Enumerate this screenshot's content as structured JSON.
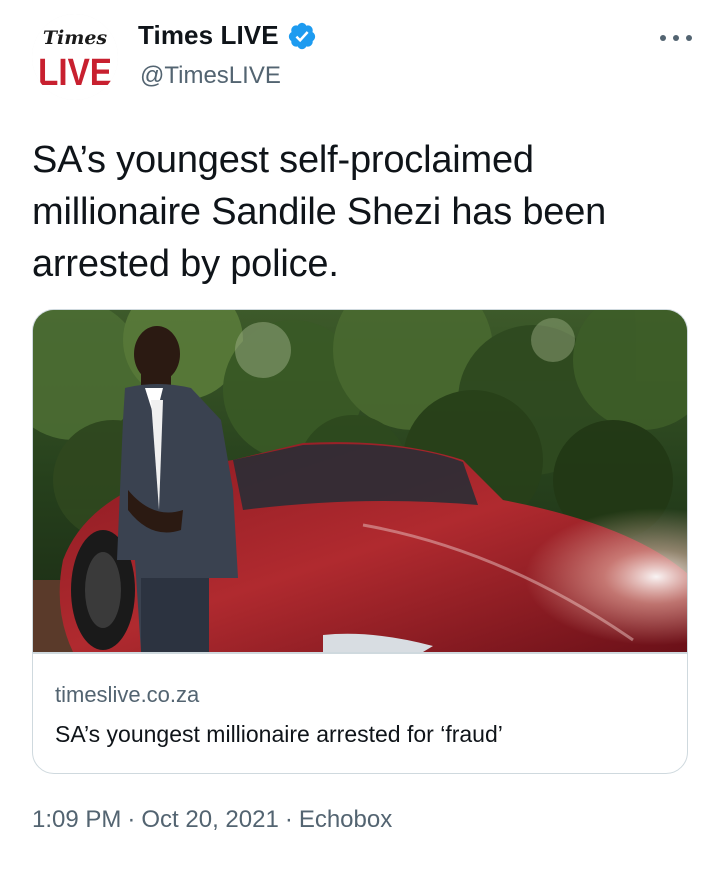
{
  "account": {
    "avatar_logo_line1": "Times",
    "avatar_logo_line2": "LIVE",
    "display_name": "Times LIVE",
    "handle": "@TimesLIVE",
    "verified": true
  },
  "tweet": {
    "text": "SA’s youngest self-proclaimed millionaire Sandile Shezi has been arrested by police."
  },
  "card": {
    "domain": "timeslive.co.za",
    "title": "SA’s youngest millionaire arrested for ‘fraud’"
  },
  "meta": {
    "time": "1:09 PM",
    "separator": "·",
    "date": "Oct 20, 2021",
    "source": "Echobox"
  },
  "colors": {
    "text": "#0f1419",
    "secondary": "#536471",
    "verified": "#1d9bf0",
    "border": "#cfd9de",
    "logo_red": "#c8202f"
  },
  "icons": {
    "verified": "verified-badge-icon",
    "more": "more-horizontal-icon"
  }
}
